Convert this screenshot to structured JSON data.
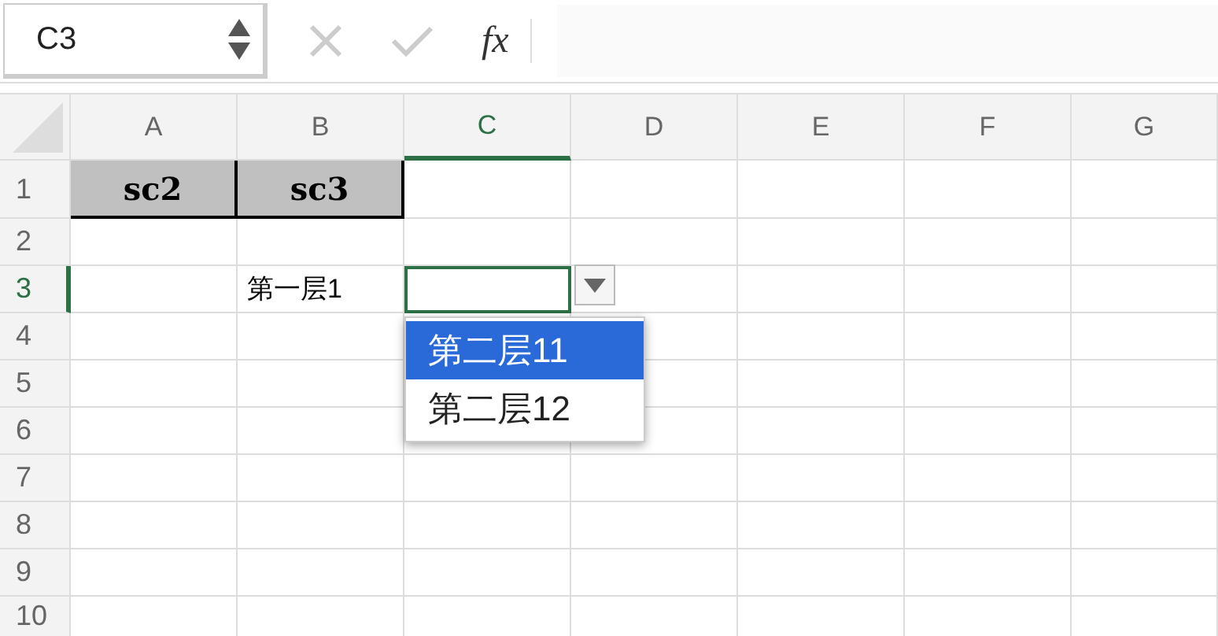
{
  "name_box": {
    "value": "C3"
  },
  "formula_bar": {
    "fx": "fx"
  },
  "columns": [
    {
      "label": "A",
      "selected": false
    },
    {
      "label": "B",
      "selected": false
    },
    {
      "label": "C",
      "selected": true
    },
    {
      "label": "D",
      "selected": false
    },
    {
      "label": "E",
      "selected": false
    },
    {
      "label": "F",
      "selected": false
    },
    {
      "label": "G",
      "selected": false
    }
  ],
  "rows": [
    {
      "label": "1",
      "selected": false,
      "cells": [
        {
          "kind": "header",
          "text": "sc2"
        },
        {
          "kind": "header",
          "text": "sc3"
        },
        {
          "kind": "plain"
        },
        {
          "kind": "plain"
        },
        {
          "kind": "plain"
        },
        {
          "kind": "plain"
        },
        {
          "kind": "plain"
        }
      ]
    },
    {
      "label": "2",
      "selected": false,
      "cells": [
        {
          "kind": "plain"
        },
        {
          "kind": "plain"
        },
        {
          "kind": "plain"
        },
        {
          "kind": "plain"
        },
        {
          "kind": "plain"
        },
        {
          "kind": "plain"
        },
        {
          "kind": "plain"
        }
      ]
    },
    {
      "label": "3",
      "selected": true,
      "cells": [
        {
          "kind": "plain"
        },
        {
          "kind": "plain",
          "text": "第一层1"
        },
        {
          "kind": "active"
        },
        {
          "kind": "plain"
        },
        {
          "kind": "plain"
        },
        {
          "kind": "plain"
        },
        {
          "kind": "plain"
        }
      ]
    },
    {
      "label": "4",
      "selected": false,
      "cells": [
        {
          "kind": "plain"
        },
        {
          "kind": "plain"
        },
        {
          "kind": "plain"
        },
        {
          "kind": "plain"
        },
        {
          "kind": "plain"
        },
        {
          "kind": "plain"
        },
        {
          "kind": "plain"
        }
      ]
    },
    {
      "label": "5",
      "selected": false,
      "cells": [
        {
          "kind": "plain"
        },
        {
          "kind": "plain"
        },
        {
          "kind": "plain"
        },
        {
          "kind": "plain"
        },
        {
          "kind": "plain"
        },
        {
          "kind": "plain"
        },
        {
          "kind": "plain"
        }
      ]
    },
    {
      "label": "6",
      "selected": false,
      "cells": [
        {
          "kind": "plain"
        },
        {
          "kind": "plain"
        },
        {
          "kind": "plain"
        },
        {
          "kind": "plain"
        },
        {
          "kind": "plain"
        },
        {
          "kind": "plain"
        },
        {
          "kind": "plain"
        }
      ]
    },
    {
      "label": "7",
      "selected": false,
      "cells": [
        {
          "kind": "plain"
        },
        {
          "kind": "plain"
        },
        {
          "kind": "plain"
        },
        {
          "kind": "plain"
        },
        {
          "kind": "plain"
        },
        {
          "kind": "plain"
        },
        {
          "kind": "plain"
        }
      ]
    },
    {
      "label": "8",
      "selected": false,
      "cells": [
        {
          "kind": "plain"
        },
        {
          "kind": "plain"
        },
        {
          "kind": "plain"
        },
        {
          "kind": "plain"
        },
        {
          "kind": "plain"
        },
        {
          "kind": "plain"
        },
        {
          "kind": "plain"
        }
      ]
    },
    {
      "label": "9",
      "selected": false,
      "cells": [
        {
          "kind": "plain"
        },
        {
          "kind": "plain"
        },
        {
          "kind": "plain"
        },
        {
          "kind": "plain"
        },
        {
          "kind": "plain"
        },
        {
          "kind": "plain"
        },
        {
          "kind": "plain"
        }
      ]
    },
    {
      "label": "10",
      "selected": false,
      "cells": [
        {
          "kind": "plain"
        },
        {
          "kind": "plain"
        },
        {
          "kind": "plain"
        },
        {
          "kind": "plain"
        },
        {
          "kind": "plain"
        },
        {
          "kind": "plain"
        },
        {
          "kind": "plain"
        }
      ]
    }
  ],
  "dropdown": {
    "options": [
      {
        "label": "第二层11",
        "selected": true
      },
      {
        "label": "第二层12",
        "selected": false
      }
    ]
  }
}
